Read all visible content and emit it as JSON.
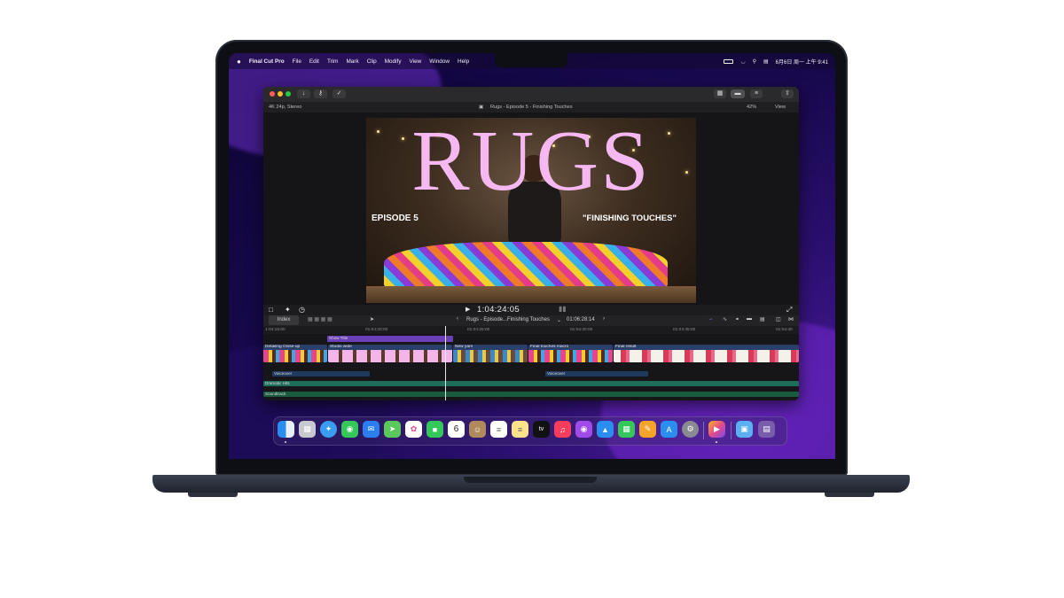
{
  "menubar": {
    "app_name": "Final Cut Pro",
    "menus": [
      "File",
      "Edit",
      "Trim",
      "Mark",
      "Clip",
      "Modify",
      "View",
      "Window",
      "Help"
    ],
    "clock": "6月6日 周一 上午 9:41"
  },
  "window": {
    "format": "4K 24p, Stereo",
    "project_title": "Rugs - Episode 5 - Finishing Touches",
    "zoom": "42%",
    "view_label": "View"
  },
  "viewer": {
    "title_text": "RUGS",
    "subtitle_left": "EPISODE 5",
    "subtitle_right": "\"FINISHING TOUCHES\"",
    "timecode": "1:04:24:05"
  },
  "timeline_toolbar": {
    "index_label": "Index",
    "project_short": "Rugs - Episode...Finishing Touches",
    "duration": "01:06:28:14"
  },
  "ruler": {
    "ticks": [
      "1:04:15:00",
      "01:04:20:00",
      "01:04:25:00",
      "01:04:30:00",
      "01:04:35:00",
      "01:04:40"
    ]
  },
  "timeline": {
    "title_clip": "Show Title",
    "clips": [
      "Detailing Close-up",
      "Studio wide",
      "New yarn",
      "Final touches macro",
      "Final result"
    ],
    "voiceover_1": "Voiceover",
    "voiceover_2": "Voiceover",
    "music_1": "Dramatic Hits",
    "music_2": "Soundtrack"
  },
  "dock": {
    "calendar_day": "6",
    "tv_label": "tv",
    "apps": [
      "finder-icon",
      "launchpad-icon",
      "safari-icon",
      "messages-icon",
      "mail-icon",
      "maps-icon",
      "photos-icon",
      "facetime-icon",
      "calendar-icon",
      "contacts-icon",
      "reminders-icon",
      "notes-icon",
      "tv-icon",
      "music-icon",
      "podcasts-icon",
      "keynote-icon",
      "numbers-icon",
      "pages-icon",
      "app-store-icon",
      "system-settings-icon",
      "final-cut-pro-icon",
      "downloads-folder-icon",
      "trash-icon"
    ]
  },
  "colors": {
    "title_pink": "#f6b8f0",
    "title_clip": "#6a3fb8",
    "voiceover_lane": "#1f3a5e",
    "music_lane": "#1f6e5a",
    "soundtrack_lane": "#1a5a3e"
  }
}
